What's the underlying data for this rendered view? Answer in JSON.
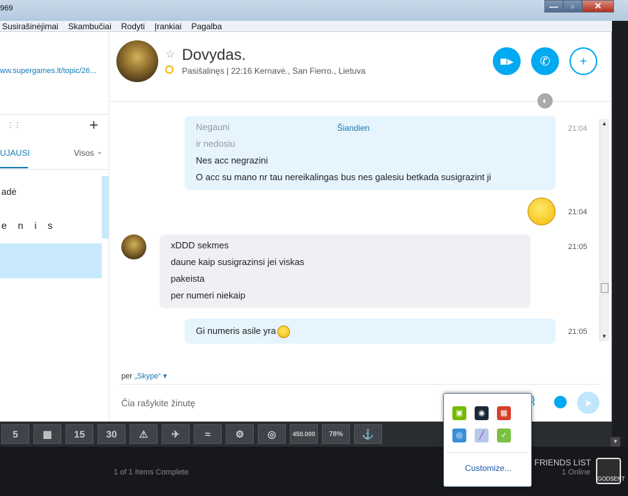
{
  "window": {
    "title_fragment": "969",
    "controls": {
      "minimize": "—",
      "maximize": "▫",
      "close": "✕"
    }
  },
  "menu": [
    "Susirašinėjimai",
    "Skambučiai",
    "Rodyti",
    "Įrankiai",
    "Pagalba"
  ],
  "sidebar": {
    "link": "ww.supergames.lt/topic/26...",
    "tabs": {
      "recent": "UJAUSI",
      "all": "Visos"
    },
    "contacts": [
      "adė",
      "e n i s"
    ]
  },
  "header": {
    "name": "Dovydas.",
    "status": "Pasišalinęs",
    "location": "22:16 Kernavė., San Fierro., Lietuva"
  },
  "conversation": {
    "day_label": "Šiandien",
    "messages_me_top": [
      "Negauni",
      "ir nedosiu",
      "Nes acc negrazini",
      "O acc su mano nr tau nereikalingas bus nes galesiu betkada susigrazint ji"
    ],
    "time_top": "21:04",
    "time_emoji": "21:04",
    "messages_them": [
      "xDDD sekmes",
      "daune kaip susigrazinsi jei viskas",
      "pakeista",
      "per numeri niekaip"
    ],
    "time_them": "21:05",
    "message_me_last": "Gi numeris asile yra",
    "time_last": "21:05"
  },
  "compose": {
    "via_prefix": "per",
    "via_channel": "„Skype“",
    "placeholder": "Čia rašykite žinutę"
  },
  "strip": [
    "5",
    "▦",
    "15",
    "30",
    "⚠",
    "✈",
    "≈",
    "⚙",
    "◎",
    "450.000",
    "78%",
    "⚓"
  ],
  "steam": {
    "items_status": "1 of 1 Items Complete",
    "friends_label": "/ FRIENDS LIST",
    "online": "1 Online",
    "badge": "GODSENT"
  },
  "tray": {
    "icons": [
      "nvidia-icon",
      "steam-icon",
      "avg-icon",
      "network-icon",
      "pen-icon",
      "evernote-icon"
    ],
    "customize": "Customize..."
  }
}
